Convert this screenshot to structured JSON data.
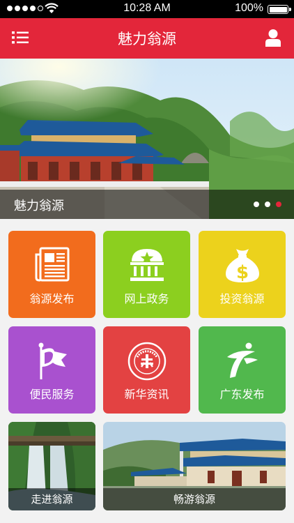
{
  "status_bar": {
    "time": "10:28 AM",
    "battery": "100%",
    "battery_level": 1.0,
    "signal_bars_filled": 4,
    "signal_bars_total": 5
  },
  "header": {
    "title": "魅力翁源",
    "menu_icon": "list-icon",
    "user_icon": "user-icon"
  },
  "banner": {
    "caption": "魅力翁源",
    "slide_count": 3,
    "active_slide": 3
  },
  "tiles": [
    {
      "label": "翁源发布",
      "icon": "newspaper-icon",
      "color": "#f26c1d"
    },
    {
      "label": "网上政务",
      "icon": "government-building-icon",
      "color": "#8ccf1f"
    },
    {
      "label": "投资翁源",
      "icon": "money-bag-icon",
      "color": "#ecd21c"
    },
    {
      "label": "便民服务",
      "icon": "flag-icon",
      "color": "#a951cf"
    },
    {
      "label": "新华资讯",
      "icon": "xinhua-seal-icon",
      "color": "#e34242"
    },
    {
      "label": "广东发布",
      "icon": "guangdong-logo-icon",
      "color": "#51b84d"
    }
  ],
  "photos": [
    {
      "label": "走进翁源"
    },
    {
      "label": "畅游翁源"
    }
  ],
  "colors": {
    "brand_red": "#e3263a",
    "background": "#f2f2f2"
  }
}
